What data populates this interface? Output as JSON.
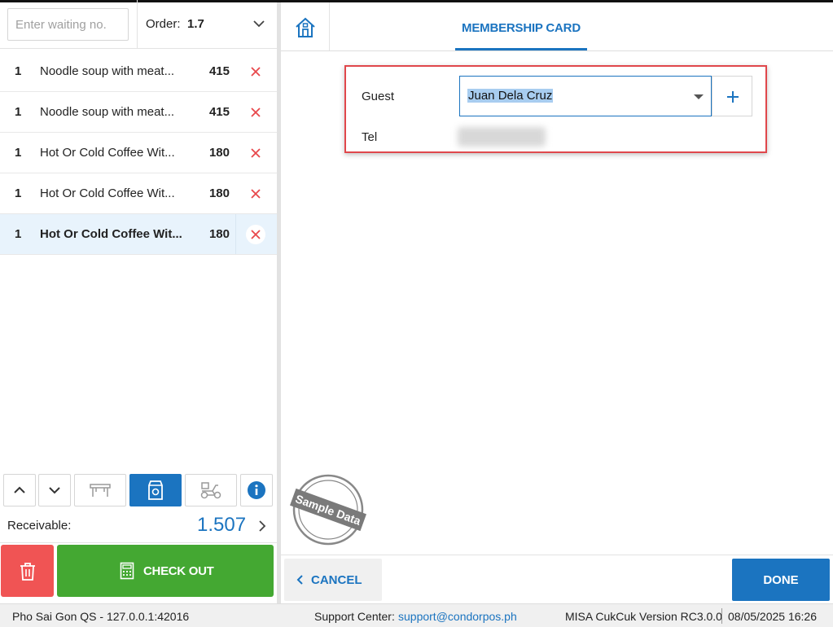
{
  "order_panel": {
    "waiting_placeholder": "Enter waiting no.",
    "order_label": "Order:",
    "order_number": "1.7",
    "items": [
      {
        "qty": "1",
        "name": "Noodle soup with meat...",
        "price": "415",
        "selected": false
      },
      {
        "qty": "1",
        "name": "Noodle soup with meat...",
        "price": "415",
        "selected": false
      },
      {
        "qty": "1",
        "name": "Hot Or Cold Coffee Wit...",
        "price": "180",
        "selected": false
      },
      {
        "qty": "1",
        "name": "Hot Or Cold Coffee Wit...",
        "price": "180",
        "selected": false
      },
      {
        "qty": "1",
        "name": "Hot Or Cold Coffee Wit...",
        "price": "180",
        "selected": true
      }
    ],
    "toolbar": [
      "arrow-up-icon",
      "arrow-down-icon",
      "dine-in-table-icon",
      "takeaway-bag-icon",
      "delivery-scooter-icon",
      "info-icon"
    ],
    "active_order_type": "takeaway",
    "receivable_label": "Receivable:",
    "receivable_value": "1.507",
    "checkout_label": "CHECK OUT"
  },
  "membership": {
    "tab_label": "MEMBERSHIP CARD",
    "guest_label": "Guest",
    "guest_value": "Juan Dela Cruz",
    "tel_label": "Tel",
    "tel_value_obscured": true
  },
  "stamp_text": "Sample Data",
  "footer": {
    "cancel_label": "CANCEL",
    "done_label": "DONE"
  },
  "status_bar": {
    "store": "Pho Sai Gon QS - 127.0.0.1:42016",
    "support_label": "Support Center:",
    "support_email": "support@condorpos.ph",
    "version": "MISA CukCuk Version RC3.0.0",
    "datetime": "08/05/2025 16:26"
  },
  "colors": {
    "accent": "#1b74c0",
    "checkout_green": "#44a832",
    "delete_red": "#f05454",
    "highlight_red": "#e0474b"
  }
}
